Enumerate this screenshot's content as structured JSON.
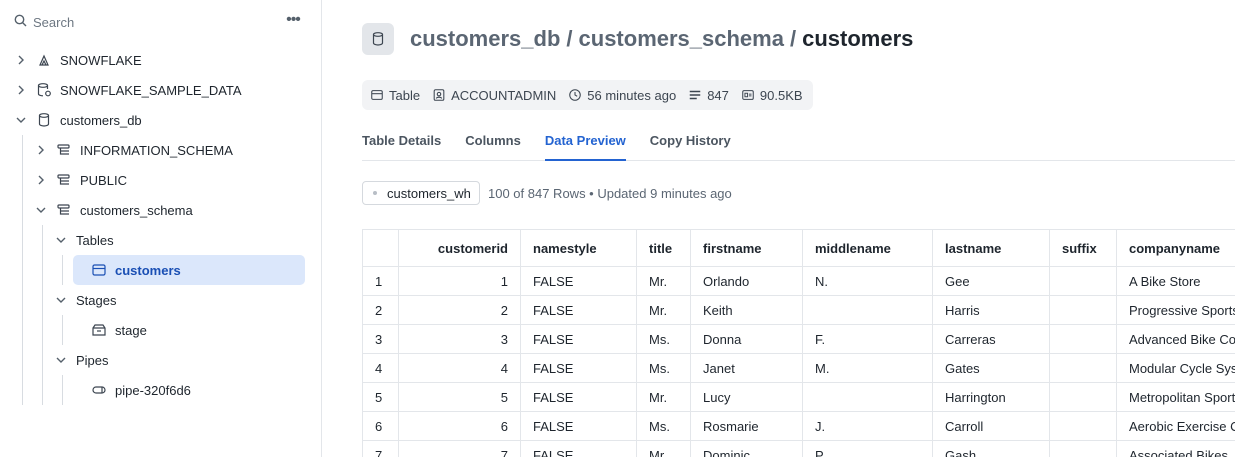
{
  "sidebar": {
    "search_placeholder": "Search",
    "more_label": "•••",
    "tree": {
      "snowflake": "SNOWFLAKE",
      "sample_data": "SNOWFLAKE_SAMPLE_DATA",
      "customers_db": "customers_db",
      "information_schema": "INFORMATION_SCHEMA",
      "public": "PUBLIC",
      "customers_schema": "customers_schema",
      "tables": "Tables",
      "customers": "customers",
      "stages": "Stages",
      "stage": "stage",
      "pipes": "Pipes",
      "pipe": "pipe-320f6d6"
    }
  },
  "header": {
    "db": "customers_db",
    "schema": "customers_schema",
    "table": "customers",
    "sep": "/"
  },
  "meta": {
    "type": "Table",
    "owner": "ACCOUNTADMIN",
    "updated": "56 minutes ago",
    "rows": "847",
    "size": "90.5KB"
  },
  "tabs": [
    "Table Details",
    "Columns",
    "Data Preview",
    "Copy History"
  ],
  "active_tab": "Data Preview",
  "warehouse": "customers_wh",
  "rows_info": "100 of 847 Rows • Updated 9 minutes ago",
  "table": {
    "columns": [
      "",
      "customerid",
      "namestyle",
      "title",
      "firstname",
      "middlename",
      "lastname",
      "suffix",
      "companyname"
    ],
    "rows": [
      [
        "1",
        "1",
        "FALSE",
        "Mr.",
        "Orlando",
        "N.",
        "Gee",
        "",
        "A Bike Store"
      ],
      [
        "2",
        "2",
        "FALSE",
        "Mr.",
        "Keith",
        "",
        "Harris",
        "",
        "Progressive Sports"
      ],
      [
        "3",
        "3",
        "FALSE",
        "Ms.",
        "Donna",
        "F.",
        "Carreras",
        "",
        "Advanced Bike Components"
      ],
      [
        "4",
        "4",
        "FALSE",
        "Ms.",
        "Janet",
        "M.",
        "Gates",
        "",
        "Modular Cycle Systems"
      ],
      [
        "5",
        "5",
        "FALSE",
        "Mr.",
        "Lucy",
        "",
        "Harrington",
        "",
        "Metropolitan Sports Supply"
      ],
      [
        "6",
        "6",
        "FALSE",
        "Ms.",
        "Rosmarie",
        "J.",
        "Carroll",
        "",
        "Aerobic Exercise Company"
      ],
      [
        "7",
        "7",
        "FALSE",
        "Mr.",
        "Dominic",
        "P.",
        "Gash",
        "",
        "Associated Bikes"
      ]
    ]
  }
}
